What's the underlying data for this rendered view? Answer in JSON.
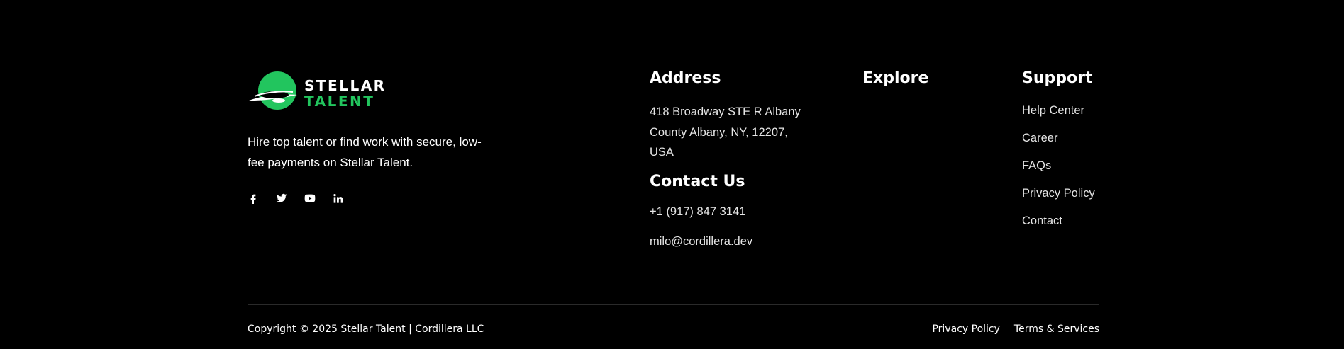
{
  "brand": {
    "wordmark_line1": "STELLAR",
    "wordmark_line2": "TALENT",
    "tagline": "Hire top talent or find work with secure, low-fee payments on Stellar Talent.",
    "accent_color": "#22c55e"
  },
  "socials": [
    {
      "name": "facebook-icon"
    },
    {
      "name": "twitter-icon"
    },
    {
      "name": "youtube-icon"
    },
    {
      "name": "linkedin-icon"
    }
  ],
  "address": {
    "title": "Address",
    "text": "418 Broadway STE R Albany County Albany, NY, 12207, USA"
  },
  "contact": {
    "title": "Contact Us",
    "phone": "+1 (917) 847 3141",
    "email": "milo@cordillera.dev"
  },
  "explore": {
    "title": "Explore"
  },
  "support": {
    "title": "Support",
    "links": [
      "Help Center",
      "Career",
      "FAQs",
      "Privacy Policy",
      "Contact"
    ]
  },
  "bottom": {
    "copyright": "Copyright © 2025 Stellar Talent | Cordillera LLC",
    "links": [
      "Privacy Policy",
      "Terms & Services"
    ]
  }
}
